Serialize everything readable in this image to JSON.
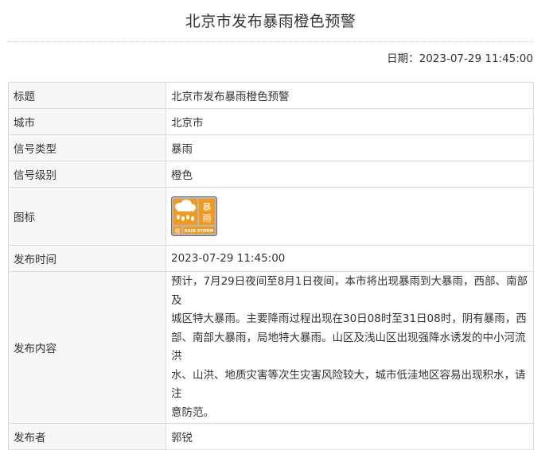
{
  "page": {
    "title": "北京市发布暴雨橙色预警",
    "date_label": "日期：",
    "date_value": "2023-07-29 11:45:00"
  },
  "rows": {
    "title": {
      "label": "标题",
      "value": "北京市发布暴雨橙色预警"
    },
    "city": {
      "label": "城市",
      "value": "北京市"
    },
    "signal_type": {
      "label": "信号类型",
      "value": "暴雨"
    },
    "signal_level": {
      "label": "信号级别",
      "value": "橙色"
    },
    "icon": {
      "label": "图标",
      "icon_name": "rainstorm-orange-warning-icon",
      "icon_text_cn": "暴雨",
      "icon_level_cn": "橙",
      "icon_text_en": "RAIN STORM"
    },
    "publish_time": {
      "label": "发布时间",
      "value": "2023-07-29 11:45:00"
    },
    "content": {
      "label": "发布内容",
      "lines": [
        "预计，7月29日夜间至8月1日夜间，本市将出现暴雨到大暴雨，西部、南部及",
        "城区特大暴雨。主要降雨过程出现在30日08时至31日08时，阴有暴雨，西",
        "部、南部大暴雨，局地特大暴雨。山区及浅山区出现强降水诱发的中小河流洪",
        "水、山洪、地质灾害等次生灾害风险较大，城市低洼地区容易出现积水，请注",
        "意防范。"
      ]
    },
    "publisher": {
      "label": "发布者",
      "value": "郭锐"
    }
  },
  "colors": {
    "icon_orange": "#f29a1e",
    "icon_border": "#6b6b6b",
    "icon_bg_gray": "#b7b7b7"
  }
}
